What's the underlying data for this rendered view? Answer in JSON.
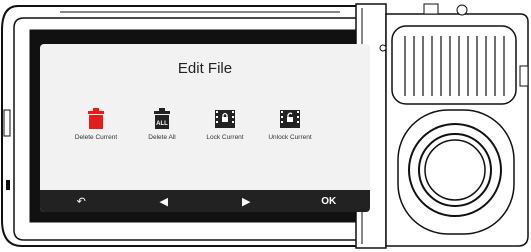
{
  "screen": {
    "title": "Edit File",
    "options": [
      {
        "label": "Delete Current",
        "icon": "trash-red-icon"
      },
      {
        "label": "Delete All",
        "icon": "trash-all-icon",
        "badge": "ALL"
      },
      {
        "label": "Lock Current",
        "icon": "lock-file-icon"
      },
      {
        "label": "Unlock Current",
        "icon": "unlock-file-icon"
      }
    ],
    "bottom_bar": {
      "back": "↶",
      "prev": "◀",
      "next": "▶",
      "ok": "OK"
    }
  },
  "colors": {
    "delete_current": "#e51c1c",
    "icon_dark": "#222222",
    "bar": "#222222"
  }
}
